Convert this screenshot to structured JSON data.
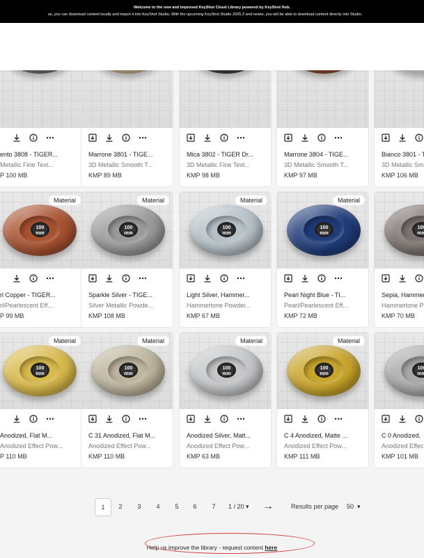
{
  "banner": {
    "line1": "Welcome to the new and improved KeyShot Cloud Library powered by KeyShot Hub.",
    "line2": "us, you can download content locally and import it into KeyShot Studio. With the upcoming KeyShot Studio 2025.2 and newer, you will be able to download content directly into Studio."
  },
  "badge_label": "Material",
  "hub_label": "100 mm",
  "cards": [
    {
      "name": "ento 3808 - TIGER...",
      "sub": "Metallic Fine Text...",
      "size": "P 100 MB",
      "color": "#6f6f6f",
      "badge": false
    },
    {
      "name": "Marrone 3801 - TIGE...",
      "sub": "3D Metallic Smooth T...",
      "size": "KMP 89 MB",
      "color": "#c9b08a",
      "badge": false
    },
    {
      "name": "Mica 3802 - TIGER Dr...",
      "sub": "3D Metallic Fine Text...",
      "size": "KMP 98 MB",
      "color": "#3c3c3c",
      "badge": false
    },
    {
      "name": "Marrone 3804 - TIGE...",
      "sub": "3D Metallic Smooth T...",
      "size": "KMP 97 MB",
      "color": "#8a4a2c",
      "badge": false
    },
    {
      "name": "Bianco 3801 - T",
      "sub": "3D Metallic Sm",
      "size": "KMP 106 MB",
      "color": "#e6e6e2",
      "badge": false
    },
    {
      "name": "rl Copper - TIGER...",
      "sub": "rl/Pearlescent Eff...",
      "size": "P 99 MB",
      "color": "#a8512f",
      "badge": true
    },
    {
      "name": "Sparkle Silver - TIGE...",
      "sub": "Silver Metallic Powde...",
      "size": "KMP 108 MB",
      "color": "#9a9a9a",
      "badge": true
    },
    {
      "name": "Light Silver, Hammer...",
      "sub": "Hammertone Powder...",
      "size": "KMP 67 MB",
      "color": "#b7c2c8",
      "badge": true
    },
    {
      "name": "Pearl Night Blue - TI...",
      "sub": "Pearl/Pearlescent Eff...",
      "size": "KMP 72 MB",
      "color": "#1f3c7a",
      "badge": true
    },
    {
      "name": "Sepia, Hammer",
      "sub": "Hammertone Pow",
      "size": "KMP 70 MB",
      "color": "#7d7370",
      "badge": true
    },
    {
      "name": "Anodized, Flat M...",
      "sub": "Anodized Effect Pow...",
      "size": "P 110 MB",
      "color": "#d8b94a",
      "badge": true
    },
    {
      "name": "C 31 Anodized, Flat M...",
      "sub": "Anodized Effect Pow...",
      "size": "KMP 110 MB",
      "color": "#bdb49c",
      "badge": true
    },
    {
      "name": "Anodized Silver, Matt...",
      "sub": "Anodized Effect Pow...",
      "size": "KMP 63 MB",
      "color": "#c4c6c7",
      "badge": true
    },
    {
      "name": "C 4 Anodized, Matte ...",
      "sub": "Anodized Effect Pow...",
      "size": "KMP 111 MB",
      "color": "#c9a52a",
      "badge": true
    },
    {
      "name": "C 0 Anodized,",
      "sub": "Anodized Effec",
      "size": "KMP 101 MB",
      "color": "#a9a9a9",
      "badge": true
    }
  ],
  "pagination": {
    "pages": [
      "1",
      "2",
      "3",
      "4",
      "5",
      "6",
      "7"
    ],
    "total": "1 / 20",
    "results_label": "Results per page",
    "per_page": "50"
  },
  "footer": {
    "text": "Help us improve the library - request content ",
    "link": "here"
  }
}
